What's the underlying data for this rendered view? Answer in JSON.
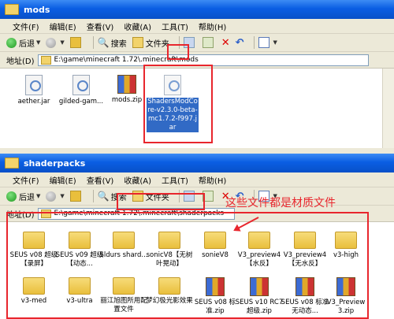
{
  "window1": {
    "title": "mods",
    "menu": [
      "文件(F)",
      "编辑(E)",
      "查看(V)",
      "收藏(A)",
      "工具(T)",
      "帮助(H)"
    ],
    "toolbar": {
      "back": "后退",
      "search": "搜索",
      "folders": "文件夹"
    },
    "address_label": "地址(D)",
    "address": "E:\\game\\minecraft 1.72\\.minecraft\\mods",
    "files": [
      {
        "name": "aether.jar",
        "type": "jar"
      },
      {
        "name": "gilded-gam...",
        "type": "jar"
      },
      {
        "name": "mods.zip",
        "type": "zip"
      },
      {
        "name": "ShadersModCore-v2.3.0-beta-mc1.7.2-f997.jar",
        "type": "jar",
        "selected": true
      }
    ]
  },
  "window2": {
    "title": "shaderpacks",
    "menu": [
      "文件(F)",
      "编辑(E)",
      "查看(V)",
      "收藏(A)",
      "工具(T)",
      "帮助(H)"
    ],
    "toolbar": {
      "back": "后退",
      "search": "搜索",
      "folders": "文件夹"
    },
    "address_label": "地址(D)",
    "address": "E:\\game\\minecraft 1.72\\.minecraft\\shaderpacks",
    "annotation": "这些文件都是材质文件",
    "files": [
      {
        "name": "SEUS v08 超级【录屏】",
        "type": "folder"
      },
      {
        "name": "SEUS v09 超级【动态...",
        "type": "folder"
      },
      {
        "name": "Sldurs shard...",
        "type": "folder"
      },
      {
        "name": "sonicV8【无树叶晃动】",
        "type": "folder"
      },
      {
        "name": "sonieV8",
        "type": "folder"
      },
      {
        "name": "V3_preview4【水反】",
        "type": "folder"
      },
      {
        "name": "V3_preview4【无水反】",
        "type": "folder"
      },
      {
        "name": "v3-high",
        "type": "folder"
      },
      {
        "name": "v3-med",
        "type": "folder"
      },
      {
        "name": "v3-ultra",
        "type": "folder"
      },
      {
        "name": "丽江旭图所用配置文件",
        "type": "folder"
      },
      {
        "name": "梦幻极光影效果",
        "type": "folder"
      },
      {
        "name": "SEUS v08 标准.zip",
        "type": "zip"
      },
      {
        "name": "SEUS v10 RC7 超级.zip",
        "type": "zip"
      },
      {
        "name": "SEUS v08 标准 无动态...",
        "type": "zip"
      },
      {
        "name": "V3_Preview 3.zip",
        "type": "zip"
      }
    ]
  }
}
